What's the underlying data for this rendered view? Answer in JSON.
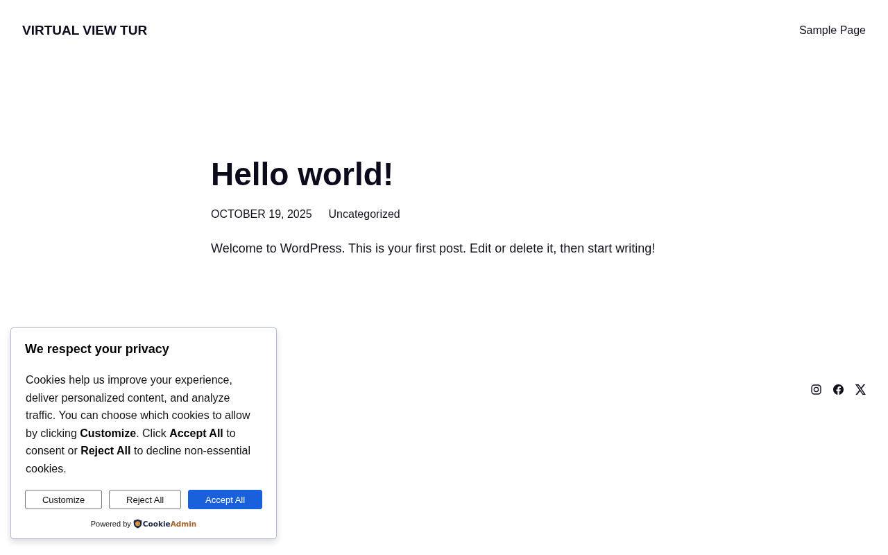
{
  "site": {
    "title": "VIRTUAL VIEW TUR",
    "nav": [
      {
        "label": "Sample Page"
      }
    ]
  },
  "post": {
    "title": "Hello world!",
    "date": "OCTOBER 19, 2025",
    "category": "Uncategorized",
    "body": "Welcome to WordPress. This is your first post. Edit or delete it, then start writing!"
  },
  "footer": {
    "social": [
      {
        "kind": "instagram"
      },
      {
        "kind": "facebook"
      },
      {
        "kind": "x"
      }
    ]
  },
  "cookie_banner": {
    "title": "We respect your privacy",
    "text": "Cookies help us improve your experience, deliver personalized content, and analyze traffic. You can choose which cookies to allow by clicking **Customize**. Click **Accept All** to consent or **Reject All** to decline non-essential cookies.",
    "buttons": [
      {
        "label": "Customize",
        "kind": "secondary"
      },
      {
        "label": "Reject All",
        "kind": "secondary"
      },
      {
        "label": "Accept All",
        "kind": "primary"
      }
    ],
    "powered_by": "Powered by",
    "brand": [
      "Cookie",
      "Admin"
    ]
  }
}
